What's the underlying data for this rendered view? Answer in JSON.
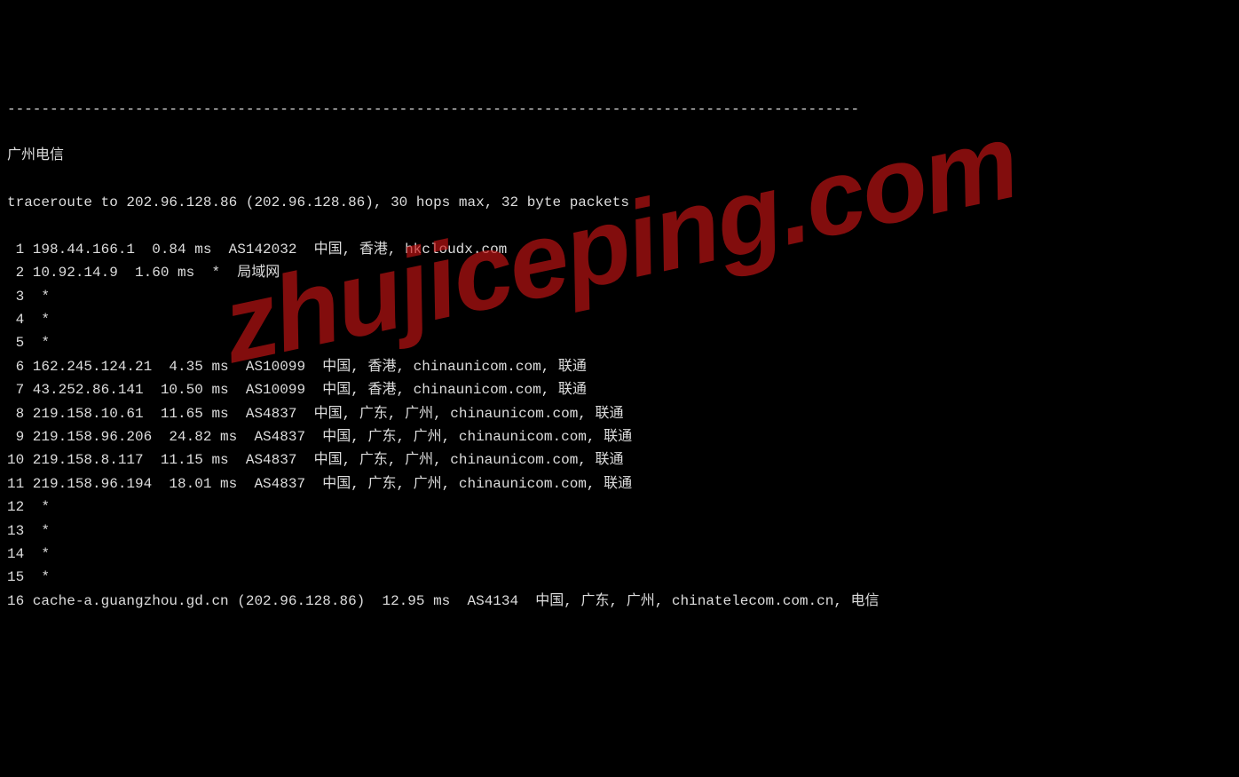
{
  "separator": "----------------------------------------------------------------------------------------------------",
  "title": "广州电信",
  "header": "traceroute to 202.96.128.86 (202.96.128.86), 30 hops max, 32 byte packets",
  "watermark": "zhujiceping.com",
  "hops": [
    {
      "num": "1",
      "ip": "198.44.166.1",
      "latency": "0.84 ms",
      "asn": "AS142032",
      "location": "中国, 香港, hkcloudx.com"
    },
    {
      "num": "2",
      "ip": "10.92.14.9",
      "latency": "1.60 ms",
      "asn": "*",
      "location": "局域网"
    },
    {
      "num": "3",
      "ip": "*",
      "latency": "",
      "asn": "",
      "location": ""
    },
    {
      "num": "4",
      "ip": "*",
      "latency": "",
      "asn": "",
      "location": ""
    },
    {
      "num": "5",
      "ip": "*",
      "latency": "",
      "asn": "",
      "location": ""
    },
    {
      "num": "6",
      "ip": "162.245.124.21",
      "latency": "4.35 ms",
      "asn": "AS10099",
      "location": "中国, 香港, chinaunicom.com, 联通"
    },
    {
      "num": "7",
      "ip": "43.252.86.141",
      "latency": "10.50 ms",
      "asn": "AS10099",
      "location": "中国, 香港, chinaunicom.com, 联通"
    },
    {
      "num": "8",
      "ip": "219.158.10.61",
      "latency": "11.65 ms",
      "asn": "AS4837",
      "location": "中国, 广东, 广州, chinaunicom.com, 联通"
    },
    {
      "num": "9",
      "ip": "219.158.96.206",
      "latency": "24.82 ms",
      "asn": "AS4837",
      "location": "中国, 广东, 广州, chinaunicom.com, 联通"
    },
    {
      "num": "10",
      "ip": "219.158.8.117",
      "latency": "11.15 ms",
      "asn": "AS4837",
      "location": "中国, 广东, 广州, chinaunicom.com, 联通"
    },
    {
      "num": "11",
      "ip": "219.158.96.194",
      "latency": "18.01 ms",
      "asn": "AS4837",
      "location": "中国, 广东, 广州, chinaunicom.com, 联通"
    },
    {
      "num": "12",
      "ip": "*",
      "latency": "",
      "asn": "",
      "location": ""
    },
    {
      "num": "13",
      "ip": "*",
      "latency": "",
      "asn": "",
      "location": ""
    },
    {
      "num": "14",
      "ip": "*",
      "latency": "",
      "asn": "",
      "location": ""
    },
    {
      "num": "15",
      "ip": "*",
      "latency": "",
      "asn": "",
      "location": ""
    },
    {
      "num": "16",
      "ip": "cache-a.guangzhou.gd.cn (202.96.128.86)",
      "latency": "12.95 ms",
      "asn": "AS4134",
      "location": "中国, 广东, 广州, chinatelecom.com.cn, 电信"
    }
  ]
}
